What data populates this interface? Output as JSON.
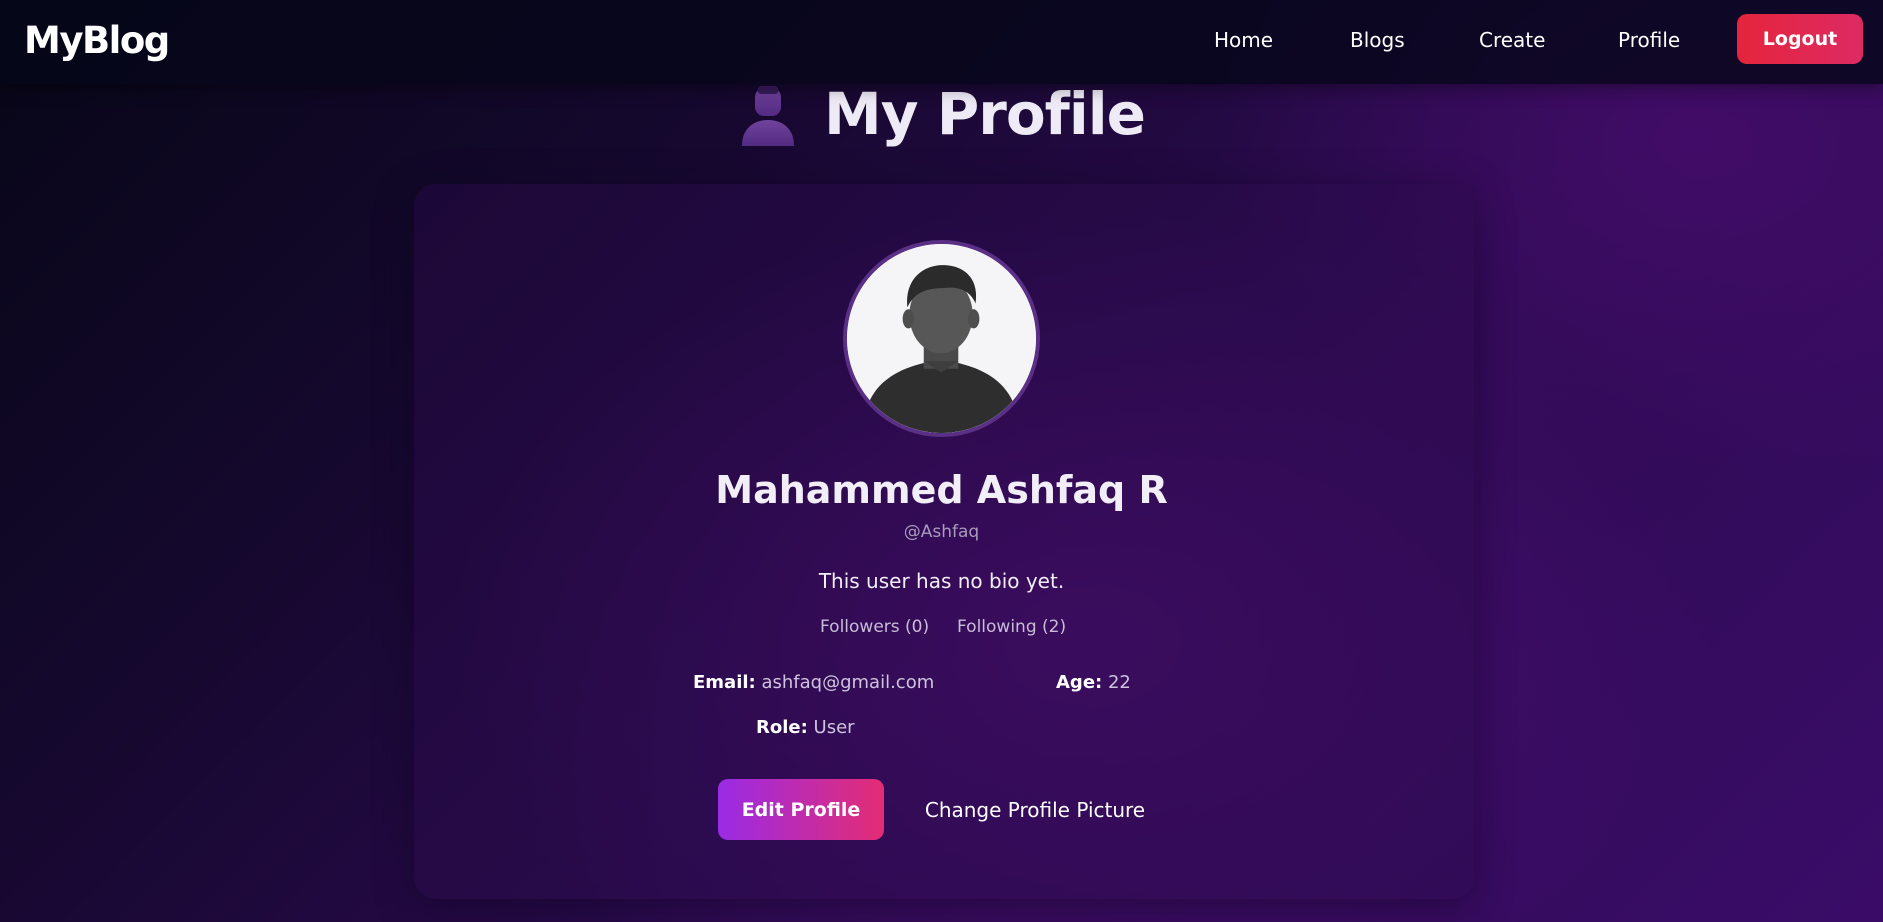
{
  "navbar": {
    "brand": "MyBlog",
    "links": [
      "Home",
      "Blogs",
      "Create",
      "Profile"
    ],
    "logout_label": "Logout",
    "logout_color": "#e5253c"
  },
  "page": {
    "title": "My Profile",
    "title_icon": "user-icon"
  },
  "profile": {
    "avatar_icon": "default-avatar-icon",
    "name": "Mahammed Ashfaq R",
    "username": "@Ashfaq",
    "bio": "This user has no bio yet.",
    "followers_label": "Followers (0)",
    "following_label": "Following (2)",
    "details": {
      "email_label": "Email:",
      "email_value": "ashfaq@gmail.com",
      "age_label": "Age:",
      "age_value": "22",
      "role_label": "Role:",
      "role_value": "User"
    },
    "edit_button_label": "Edit Profile",
    "change_picture_label": "Change Profile Picture",
    "accent_gradient": [
      "#9a2be6",
      "#e42c74"
    ]
  }
}
